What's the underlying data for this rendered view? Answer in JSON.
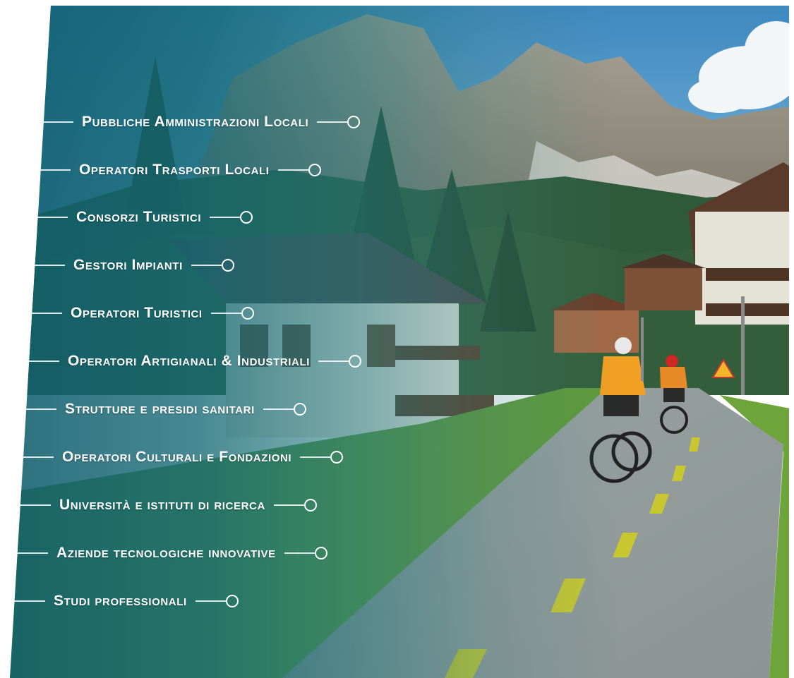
{
  "items": [
    {
      "label": "Pubbliche Amministrazioni Locali"
    },
    {
      "label": "Operatori Trasporti Locali"
    },
    {
      "label": "Consorzi Turistici"
    },
    {
      "label": "Gestori Impianti"
    },
    {
      "label": "Operatori Turistici"
    },
    {
      "label": "Operatori Artigianali & Industriali"
    },
    {
      "label": "Strutture e presidi sanitari"
    },
    {
      "label": "Operatori Culturali e Fondazioni"
    },
    {
      "label": "Università e istituti di ricerca"
    },
    {
      "label": "Aziende tecnologiche innovative"
    },
    {
      "label": "Studi professionali"
    }
  ]
}
